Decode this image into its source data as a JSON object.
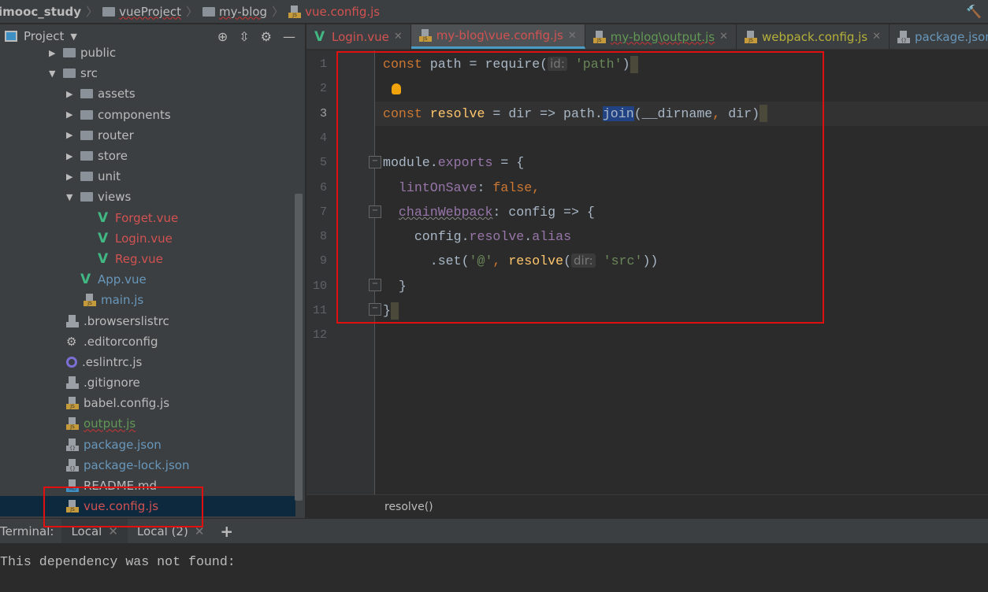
{
  "breadcrumb": [
    {
      "label": "imooc_study",
      "icon": "none",
      "color": "#bbbbbb"
    },
    {
      "label": "vueProject",
      "icon": "folder-icon",
      "color": "#bbbbbb"
    },
    {
      "label": "my-blog",
      "icon": "folder-icon",
      "color": "#bbbbbb"
    },
    {
      "label": "vue.config.js",
      "icon": "js-file-icon",
      "color": "#d25252"
    }
  ],
  "sidebar": {
    "title": "Project",
    "tree": [
      {
        "label": "public",
        "type": "folder",
        "depth": 1,
        "expanded": false,
        "color": "def"
      },
      {
        "label": "src",
        "type": "folder",
        "depth": 1,
        "expanded": true,
        "color": "def"
      },
      {
        "label": "assets",
        "type": "folder",
        "depth": 2,
        "expanded": false,
        "color": "def"
      },
      {
        "label": "components",
        "type": "folder",
        "depth": 2,
        "expanded": false,
        "color": "def"
      },
      {
        "label": "router",
        "type": "folder",
        "depth": 2,
        "expanded": false,
        "color": "def"
      },
      {
        "label": "store",
        "type": "folder",
        "depth": 2,
        "expanded": false,
        "color": "def"
      },
      {
        "label": "unit",
        "type": "folder",
        "depth": 2,
        "expanded": false,
        "color": "def"
      },
      {
        "label": "views",
        "type": "folder",
        "depth": 2,
        "expanded": true,
        "color": "def"
      },
      {
        "label": "Forget.vue",
        "type": "vue",
        "depth": 3,
        "color": "red"
      },
      {
        "label": "Login.vue",
        "type": "vue",
        "depth": 3,
        "color": "red"
      },
      {
        "label": "Reg.vue",
        "type": "vue",
        "depth": 3,
        "color": "red"
      },
      {
        "label": "App.vue",
        "type": "vue",
        "depth": 2,
        "color": "blue"
      },
      {
        "label": "main.js",
        "type": "js",
        "depth": 2,
        "color": "blue"
      },
      {
        "label": ".browserslistrc",
        "type": "doc",
        "depth": 1,
        "color": "def"
      },
      {
        "label": ".editorconfig",
        "type": "gear",
        "depth": 1,
        "color": "def"
      },
      {
        "label": ".eslintrc.js",
        "type": "eslint",
        "depth": 1,
        "color": "def"
      },
      {
        "label": ".gitignore",
        "type": "doc",
        "depth": 1,
        "color": "def"
      },
      {
        "label": "babel.config.js",
        "type": "js",
        "depth": 1,
        "color": "def"
      },
      {
        "label": "output.js",
        "type": "js",
        "depth": 1,
        "color": "green",
        "wavy": true
      },
      {
        "label": "package.json",
        "type": "json",
        "depth": 1,
        "color": "blue"
      },
      {
        "label": "package-lock.json",
        "type": "json",
        "depth": 1,
        "color": "blue"
      },
      {
        "label": "README.md",
        "type": "md",
        "depth": 1,
        "color": "def"
      },
      {
        "label": "vue.config.js",
        "type": "js",
        "depth": 1,
        "color": "red",
        "selected": true
      }
    ]
  },
  "tabs": [
    {
      "label": "Login.vue",
      "icon": "vue",
      "color": "red"
    },
    {
      "label": "my-blog\\vue.config.js",
      "icon": "js",
      "color": "red",
      "active": true
    },
    {
      "label": "my-blog\\output.js",
      "icon": "js",
      "color": "green",
      "wavy": true
    },
    {
      "label": "webpack.config.js",
      "icon": "js",
      "color": "olive"
    },
    {
      "label": "package.json",
      "icon": "json",
      "color": "blue"
    }
  ],
  "editor": {
    "line_numbers": [
      "1",
      "2",
      "3",
      "4",
      "5",
      "6",
      "7",
      "8",
      "9",
      "10",
      "11",
      "12"
    ],
    "current_line": "3",
    "lines": [
      [
        [
          "kw",
          "const "
        ],
        [
          "",
          "path = require("
        ],
        [
          "hint",
          "id:"
        ],
        [
          "str",
          " 'path'"
        ],
        [
          "",
          ")"
        ],
        [
          "bh",
          ""
        ]
      ],
      [],
      [
        [
          "kw",
          "const "
        ],
        [
          "fn",
          "resolve"
        ],
        [
          "",
          " = dir => path."
        ],
        [
          "selw",
          "join"
        ],
        [
          "",
          "(__dirname"
        ],
        [
          "kw",
          ","
        ],
        [
          "",
          " dir)"
        ],
        [
          "bh",
          ""
        ]
      ],
      [],
      [
        [
          "",
          "module."
        ],
        [
          "prop",
          "exports"
        ],
        [
          "",
          " = {"
        ]
      ],
      [
        [
          "",
          "  "
        ],
        [
          "prop",
          "lintOnSave"
        ],
        [
          "",
          ": "
        ],
        [
          "kw",
          "false,"
        ]
      ],
      [
        [
          "",
          "  "
        ],
        [
          "propsq",
          "chainWebpack"
        ],
        [
          "",
          ": config => {"
        ]
      ],
      [
        [
          "",
          "    config."
        ],
        [
          "prop",
          "resolve"
        ],
        [
          "",
          "."
        ],
        [
          "prop",
          "alias"
        ]
      ],
      [
        [
          "",
          "      .set("
        ],
        [
          "str",
          "'@'"
        ],
        [
          "kw",
          ","
        ],
        [
          " fn",
          " resolve"
        ],
        [
          "",
          "("
        ],
        [
          "hint",
          "dir:"
        ],
        [
          "str",
          " 'src'"
        ],
        [
          "",
          "))"
        ]
      ],
      [
        [
          "",
          "  }"
        ]
      ],
      [
        [
          "",
          "}"
        ],
        [
          "bh",
          ""
        ]
      ],
      []
    ]
  },
  "status": {
    "breadcrumb": "resolve()"
  },
  "terminal": {
    "label": "Terminal:",
    "tabs": [
      "Local",
      "Local (2)"
    ],
    "add_label": "+",
    "output": "This dependency was not found:"
  }
}
